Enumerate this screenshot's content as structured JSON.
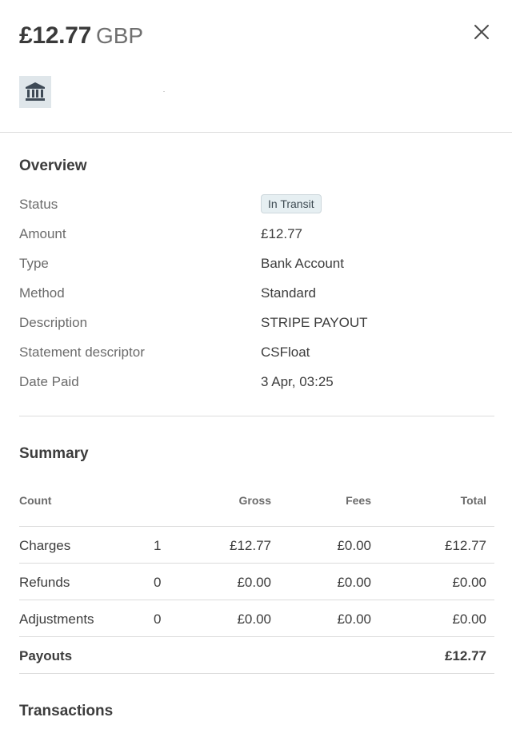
{
  "header": {
    "amount": "£12.77",
    "currency": "GBP",
    "close_icon": "close-icon",
    "bank_icon": "bank-icon"
  },
  "overview": {
    "title": "Overview",
    "status_label": "Status",
    "status_value": "In Transit",
    "amount_label": "Amount",
    "amount_value": "£12.77",
    "type_label": "Type",
    "type_value": "Bank Account",
    "method_label": "Method",
    "method_value": "Standard",
    "description_label": "Description",
    "description_value": "STRIPE PAYOUT",
    "statement_label": "Statement descriptor",
    "statement_value": "CSFloat",
    "date_label": "Date Paid",
    "date_value": "3 Apr, 03:25"
  },
  "summary": {
    "title": "Summary",
    "columns": {
      "count": "Count",
      "gross": "Gross",
      "fees": "Fees",
      "total": "Total"
    },
    "rows": [
      {
        "name": "Charges",
        "count": "1",
        "gross": "£12.77",
        "fees": "£0.00",
        "total": "£12.77"
      },
      {
        "name": "Refunds",
        "count": "0",
        "gross": "£0.00",
        "fees": "£0.00",
        "total": "£0.00"
      },
      {
        "name": "Adjustments",
        "count": "0",
        "gross": "£0.00",
        "fees": "£0.00",
        "total": "£0.00"
      }
    ],
    "payouts": {
      "name": "Payouts",
      "total": "£12.77"
    }
  },
  "transactions": {
    "title": "Transactions"
  },
  "colors": {
    "badge_bg": "#e6eff2",
    "icon_bg": "#dfe6ea",
    "divider": "#dcdcdc"
  }
}
